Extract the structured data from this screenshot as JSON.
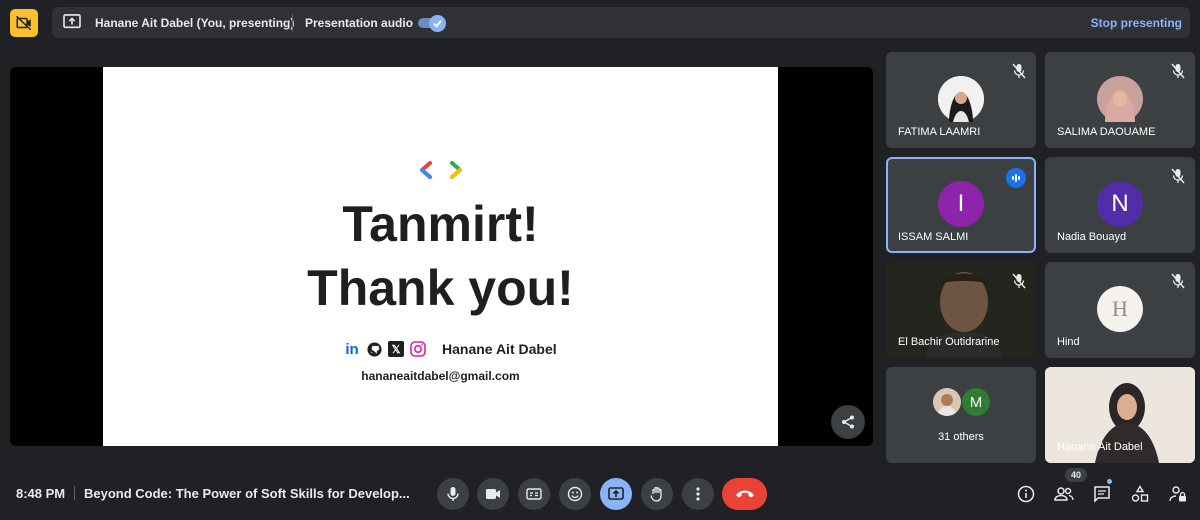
{
  "topbar": {
    "presenter": "Hanane Ait Dabel (You, presenting)",
    "audio_label": "Presentation audio",
    "audio_on": true,
    "stop_label": "Stop presenting"
  },
  "slide": {
    "title_line1": "Tanmirt!",
    "title_line2": "Thank you!",
    "social_name": "Hanane Ait Dabel",
    "email": "hananeaitdabel@gmail.com"
  },
  "participants": [
    {
      "name": "FATIMA LAAMRI",
      "muted": true,
      "avatar": "photo"
    },
    {
      "name": "SALIMA DAOUAME",
      "muted": true,
      "avatar": "photo"
    },
    {
      "name": "ISSAM SALMI",
      "initial": "I",
      "speaking": true,
      "color": "#8e24aa"
    },
    {
      "name": "Nadia Bouayd",
      "initial": "N",
      "muted": true,
      "color": "#512da8"
    },
    {
      "name": "El Bachir Outidrarine",
      "muted": true,
      "avatar": "video"
    },
    {
      "name": "Hind",
      "initial": "H",
      "muted": true,
      "avatar": "logo"
    },
    {
      "name": "31 others",
      "initial": "M",
      "color": "#2e7d32"
    },
    {
      "name": "Hanane Ait Dabel",
      "avatar": "video"
    }
  ],
  "bottombar": {
    "time": "8:48 PM",
    "meeting_title": "Beyond Code: The Power of Soft Skills for Develop...",
    "people_count": "40"
  }
}
